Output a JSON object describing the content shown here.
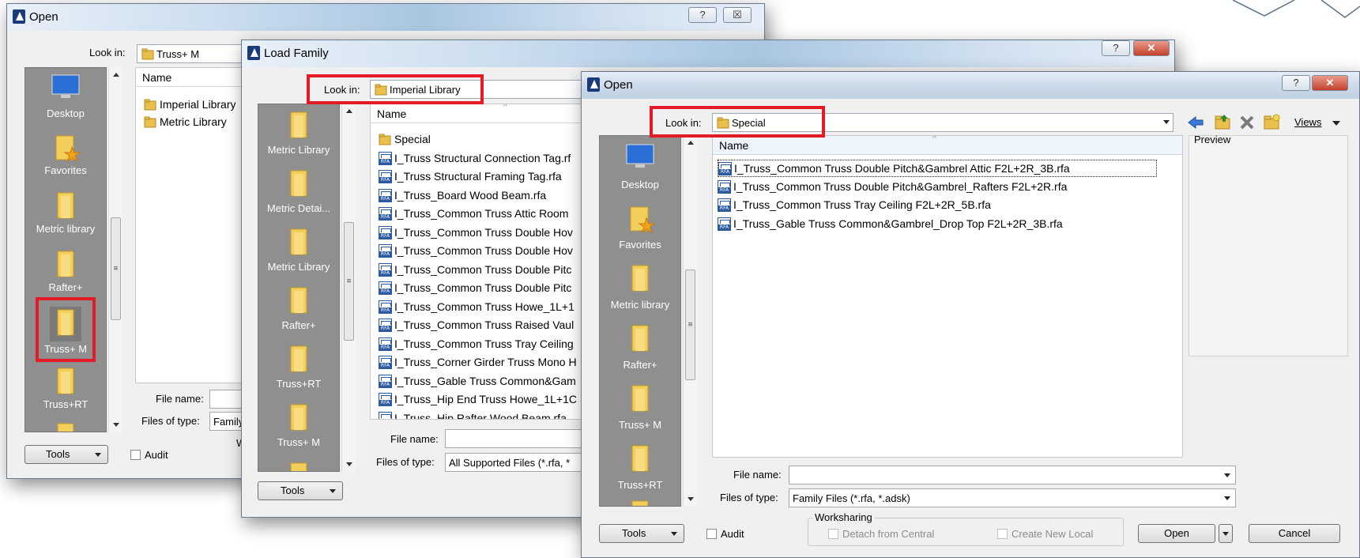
{
  "dialog1": {
    "title": "Open",
    "help_btn": "?",
    "close_btn": "☒",
    "look_in_label": "Look in:",
    "look_in_value": "Truss+ M",
    "places": [
      "Desktop",
      "Favorites",
      "Metric library",
      "Rafter+",
      "Truss+ M",
      "Truss+RT"
    ],
    "column_name": "Name",
    "items": [
      "Imperial Library",
      "Metric Library"
    ],
    "file_name_label": "File name:",
    "files_of_type_label": "Files of type:",
    "files_of_type_value": "Family",
    "tools_label": "Tools",
    "audit_label": "Audit",
    "group_partial": "W"
  },
  "dialog2": {
    "title": "Load Family",
    "help_btn": "?",
    "close_btn": "✕",
    "look_in_label": "Look in:",
    "look_in_value": "Imperial Library",
    "places": [
      "Metric Library",
      "Metric Detai...",
      "Metric Library",
      "Rafter+",
      "Truss+RT",
      "Truss+ M"
    ],
    "column_name": "Name",
    "items": [
      "Special",
      "I_Truss Structural Connection Tag.rf",
      "I_Truss Structural Framing Tag.rfa",
      "I_Truss_Board Wood Beam.rfa",
      "I_Truss_Common Truss Attic Room",
      "I_Truss_Common Truss Double Hov",
      "I_Truss_Common Truss Double Hov",
      "I_Truss_Common Truss Double Pitc",
      "I_Truss_Common Truss Double Pitc",
      "I_Truss_Common Truss Howe_1L+1",
      "I_Truss_Common Truss Raised Vaul",
      "I_Truss_Common Truss Tray Ceiling",
      "I_Truss_Corner Girder Truss Mono H",
      "I_Truss_Gable Truss Common&Gam",
      "I_Truss_Hip End Truss Howe_1L+1C",
      "I_Truss_Hip Rafter Wood Beam.rfa"
    ],
    "file_name_label": "File name:",
    "files_of_type_label": "Files of type:",
    "files_of_type_value": "All Supported Files  (*.rfa, *",
    "tools_label": "Tools"
  },
  "dialog3": {
    "title": "Open",
    "help_btn": "?",
    "close_btn": "✕",
    "look_in_label": "Look in:",
    "look_in_value": "Special",
    "views_label": "Views",
    "preview_label": "Preview",
    "places": [
      "Desktop",
      "Favorites",
      "Metric library",
      "Rafter+",
      "Truss+ M",
      "Truss+RT"
    ],
    "column_name": "Name",
    "items": [
      "I_Truss_Common Truss Double Pitch&Gambrel Attic F2L+2R_3B.rfa",
      "I_Truss_Common Truss Double Pitch&Gambrel_Rafters F2L+2R.rfa",
      "I_Truss_Common Truss Tray Ceiling F2L+2R_5B.rfa",
      "I_Truss_Gable Truss Common&Gambrel_Drop Top F2L+2R_3B.rfa"
    ],
    "file_name_label": "File name:",
    "file_name_value": "",
    "files_of_type_label": "Files of type:",
    "files_of_type_value": "Family Files  (*.rfa, *.adsk)",
    "tools_label": "Tools",
    "audit_label": "Audit",
    "worksharing_label": "Worksharing",
    "detach_label": "Detach from Central",
    "create_local_label": "Create New Local",
    "open_label": "Open",
    "cancel_label": "Cancel"
  },
  "colors": {
    "highlight_red": "#e21b24",
    "places_bg": "#8f8f8f",
    "dialog_bg": "#f0f0f0"
  }
}
